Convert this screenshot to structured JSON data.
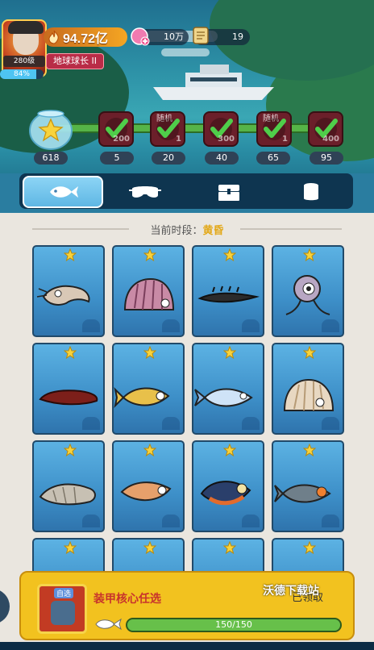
{
  "player": {
    "level_label": "280级",
    "exp_percent_label": "84%",
    "exp_percent": 0.84,
    "power": "94.72亿",
    "title": "地球球长 II"
  },
  "resources": {
    "gem": "10万",
    "scroll": "19"
  },
  "milestones": [
    {
      "count": "618",
      "icon": "fishbowl-star-icon"
    },
    {
      "count": "5",
      "threshold": "200",
      "random_label": "",
      "icon": "check-icon"
    },
    {
      "count": "20",
      "threshold": "1",
      "random_label": "随机",
      "icon": "check-icon"
    },
    {
      "count": "40",
      "threshold": "300",
      "random_label": "",
      "icon": "check-icon"
    },
    {
      "count": "65",
      "threshold": "1",
      "random_label": "随机",
      "icon": "check-icon"
    },
    {
      "count": "95",
      "threshold": "400",
      "random_label": "",
      "icon": "check-icon"
    }
  ],
  "tabs": [
    {
      "icon": "fish-icon",
      "active": true
    },
    {
      "icon": "goggles-icon",
      "active": false
    },
    {
      "icon": "chest-icon",
      "active": false
    },
    {
      "icon": "cup-icon",
      "active": false
    }
  ],
  "period": {
    "label": "当前时段：",
    "value": "黄昏"
  },
  "cards": [
    {
      "icon": "shrimp-icon",
      "color": "#d9c8b6"
    },
    {
      "icon": "clam-pink-icon",
      "color": "#c98aa6"
    },
    {
      "icon": "eel-spiky-icon",
      "color": "#2b2b2b"
    },
    {
      "icon": "squid-small-icon",
      "color": "#b8a7c3"
    },
    {
      "icon": "sea-cucumber-icon",
      "color": "#7c1f1a"
    },
    {
      "icon": "yellow-fish-icon",
      "color": "#e8c04a"
    },
    {
      "icon": "blue-fish-icon",
      "color": "#cfe3f7"
    },
    {
      "icon": "scallop-icon",
      "color": "#e8d8c2"
    },
    {
      "icon": "conch-icon",
      "color": "#c7c0b3"
    },
    {
      "icon": "squid-orange-icon",
      "color": "#e6a06b"
    },
    {
      "icon": "piranha-icon",
      "color": "#2a3f6b"
    },
    {
      "icon": "grey-fish-icon",
      "color": "#6f7f8a"
    },
    {
      "icon": "hidden-fish-icon",
      "color": "#5cb2e3"
    },
    {
      "icon": "hidden-fish-icon",
      "color": "#5cb2e3"
    },
    {
      "icon": "hidden-fish-icon",
      "color": "#5cb2e3"
    },
    {
      "icon": "hidden-fish-icon",
      "color": "#5cb2e3"
    }
  ],
  "reward": {
    "self_select_label": "自选",
    "name": "装甲核心任选",
    "claim_label": "已领取",
    "watermark": "沃德下载站",
    "progress_label": "150/150",
    "progress": 1.0
  }
}
